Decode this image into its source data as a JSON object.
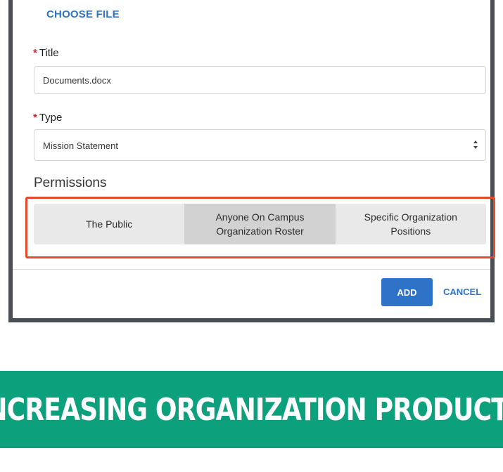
{
  "upload": {
    "choose_file_label": "CHOOSE FILE"
  },
  "form": {
    "required_marker": "*",
    "title_label": "Title",
    "title_value": "Documents.docx",
    "type_label": "Type",
    "type_value": "Mission Statement"
  },
  "permissions": {
    "heading": "Permissions",
    "options": [
      {
        "line1": "The Public",
        "line2": ""
      },
      {
        "line1": "Anyone On Campus",
        "line2": "Organization Roster"
      },
      {
        "line1": "Specific Organization",
        "line2": "Positions"
      }
    ],
    "selected_index": 1,
    "highlight_color": "#e54a2a"
  },
  "actions": {
    "add_label": "ADD",
    "cancel_label": "CANCEL"
  },
  "banner": {
    "text": "NCREASING ORGANIZATION PRODUCTI",
    "color": "#0da07d"
  },
  "colors": {
    "accent": "#2f73c8",
    "required": "#c3262c"
  }
}
